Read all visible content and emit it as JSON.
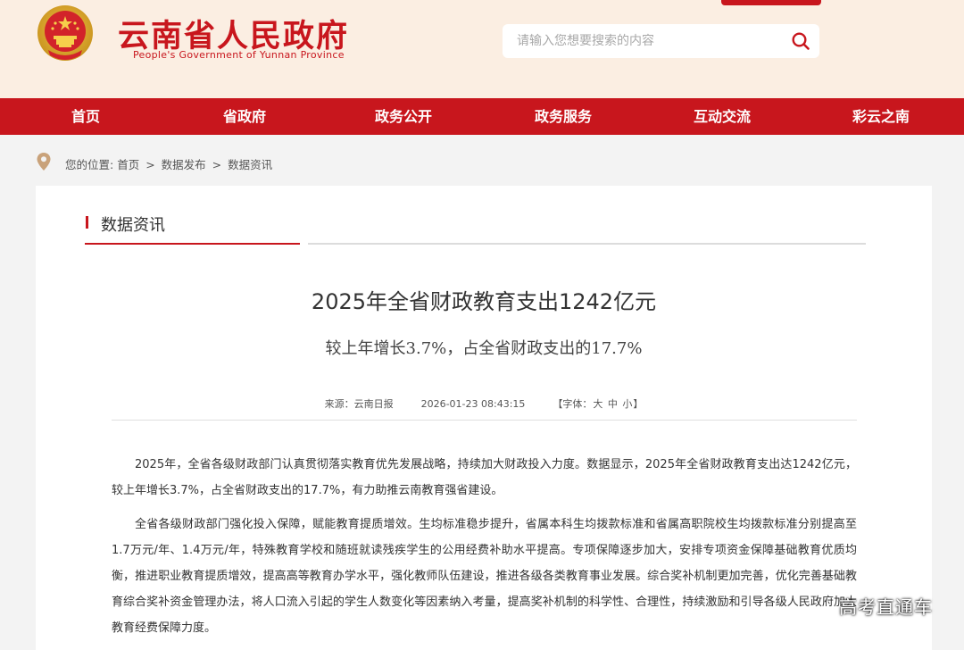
{
  "header": {
    "site_title": "云南省人民政府",
    "site_subtitle": "People's Government of Yunnan Province",
    "search": {
      "placeholder": "请输入您想要搜索的内容"
    }
  },
  "nav": {
    "items": [
      {
        "label": "首页"
      },
      {
        "label": "省政府"
      },
      {
        "label": "政务公开"
      },
      {
        "label": "政务服务"
      },
      {
        "label": "互动交流"
      },
      {
        "label": "彩云之南"
      }
    ]
  },
  "breadcrumb": {
    "prefix": "您的位置:",
    "items": [
      "首页",
      "数据发布",
      "数据资讯"
    ],
    "separator": ">"
  },
  "section": {
    "title": "数据资讯"
  },
  "article": {
    "title": "2025年全省财政教育支出1242亿元",
    "subtitle": "较上年增长3.7%，占全省财政支出的17.7%",
    "meta": {
      "source": "来源：云南日报",
      "datetime": "2026-01-23 08:43:15",
      "font_label_open": "【字体：",
      "font_large": "大",
      "font_medium": "中",
      "font_small": "小",
      "font_label_close": "】"
    },
    "paragraphs": [
      "2025年，全省各级财政部门认真贯彻落实教育优先发展战略，持续加大财政投入力度。数据显示，2025年全省财政教育支出达1242亿元，较上年增长3.7%，占全省财政支出的17.7%，有力助推云南教育强省建设。",
      "全省各级财政部门强化投入保障，赋能教育提质增效。生均标准稳步提升，省属本科生均拨款标准和省属高职院校生均拨款标准分别提高至1.7万元/年、1.4万元/年，特殊教育学校和随班就读残疾学生的公用经费补助水平提高。专项保障逐步加大，安排专项资金保障基础教育优质均衡，推进职业教育提质增效，提高高等教育办学水平，强化教师队伍建设，推进各级各类教育事业发展。综合奖补机制更加完善，优化完善基础教育综合奖补资金管理办法，将人口流入引起的学生人数变化等因素纳入考量，提高奖补机制的科学性、合理性，持续激励和引导各级人民政府加大教育经费保障力度。"
    ]
  },
  "watermark": {
    "text": "高考直通车"
  },
  "colors": {
    "brand_red": "#c8161d",
    "header_bg": "#fbeee2",
    "page_bg": "#f3f3f3"
  },
  "icons": {
    "emblem": "national-emblem-icon",
    "search": "search-icon",
    "location": "location-pin-icon"
  }
}
